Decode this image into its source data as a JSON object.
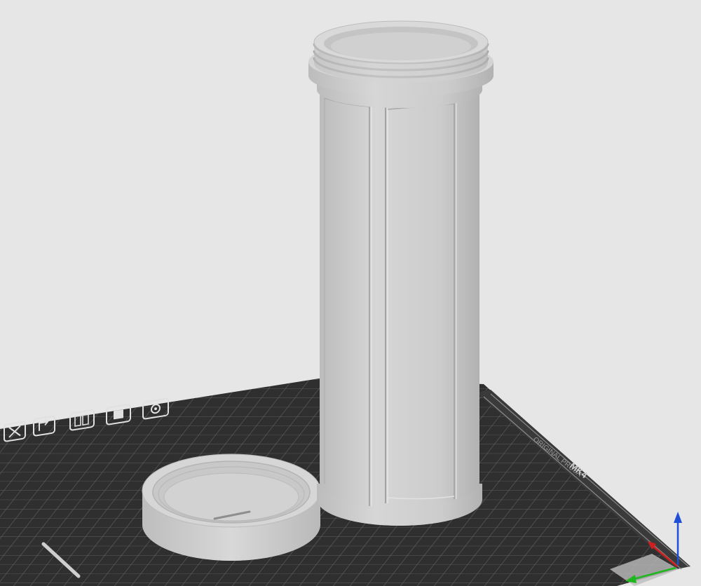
{
  "app": {
    "view": "3D plater view",
    "bed_label_1": "ORIGINAL PRUSA",
    "bed_label_2": "MK4"
  },
  "colors": {
    "background": "#e6e6e6",
    "bed": "#2f2f2f",
    "grid": "#6b6b6b",
    "model": "#cfcfcf",
    "axis_x": "#d21d1d",
    "axis_y": "#1eb81e",
    "axis_z": "#1f4fd6"
  },
  "bed_icons": [
    {
      "name": "x-mark-icon"
    },
    {
      "name": "rotate-arrow-icon"
    },
    {
      "name": "sheet-icon"
    },
    {
      "name": "square-icon"
    },
    {
      "name": "camera-icon"
    }
  ],
  "objects": [
    {
      "name": "cylinder-container"
    },
    {
      "name": "screw-lid"
    }
  ],
  "axes": [
    "x",
    "y",
    "z"
  ]
}
